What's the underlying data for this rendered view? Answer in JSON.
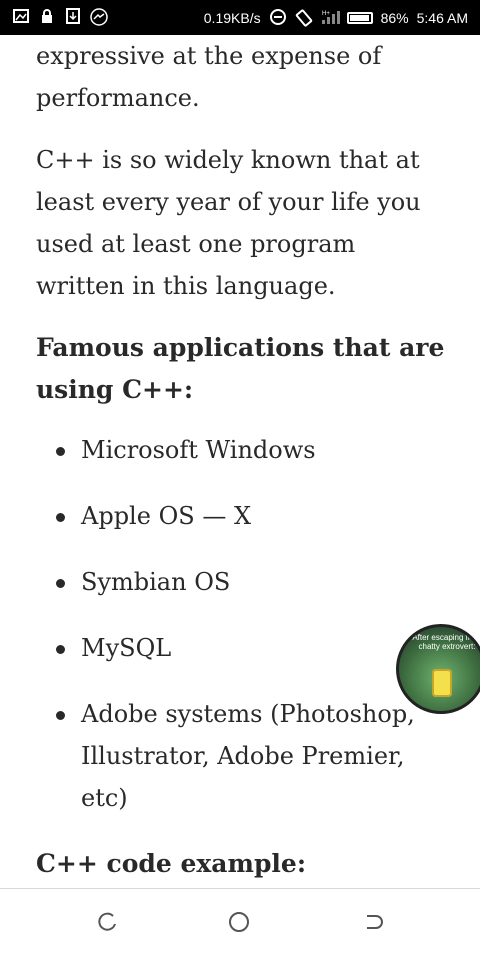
{
  "status_bar": {
    "network_speed": "0.19KB/s",
    "battery_percent": "86%",
    "time": "5:46 AM",
    "icons": [
      "screenshot-icon",
      "lock-icon",
      "download-icon",
      "messenger-icon",
      "do-not-disturb-icon",
      "rotation-icon",
      "signal-icon",
      "battery-icon"
    ]
  },
  "article": {
    "para1": "expressive at the expense of performance.",
    "para2": "C++ is so widely known that at least every year of your life you used at least one program written in this language.",
    "heading1": "Famous applications that are using C++:",
    "apps": [
      "Microsoft Windows",
      "Apple OS — X",
      "Symbian OS",
      "MySQL",
      "Adobe systems (Photoshop, Illustrator, Adobe Premier, etc)"
    ],
    "heading2": "C++ code example:"
  },
  "floating_bubble": {
    "caption": "After escaping from chatty extrovert:"
  },
  "nav_bar": {
    "icons": [
      "recent-apps-icon",
      "home-icon",
      "back-icon"
    ]
  }
}
